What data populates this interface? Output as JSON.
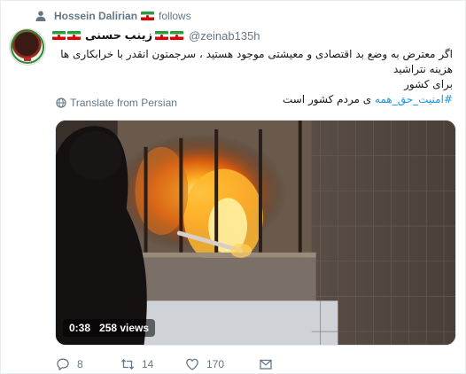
{
  "context": {
    "user_name": "Hossein Dalirian",
    "action": "follows",
    "icon": "person-icon"
  },
  "author": {
    "display_name": "زینب حسنی",
    "handle": "@zeinab135h"
  },
  "tweet": {
    "line1": "اگر معترض به وضع بد اقتصادی و معیشتی موجود هستید ، سرجمتون انقدر با خرابکاری ها هزینه نتراشید",
    "line2": "برای کشور",
    "hashtag": "#امنیت_حق_همه",
    "line3_rest": "ی مردم کشور است"
  },
  "translate": {
    "label": "Translate from Persian",
    "icon": "globe-icon"
  },
  "media": {
    "time": "0:38",
    "views": "258 views"
  },
  "actions": {
    "reply_count": "8",
    "retweet_count": "14",
    "like_count": "170",
    "icons": [
      "reply-icon",
      "retweet-icon",
      "like-icon",
      "message-icon"
    ]
  },
  "colors": {
    "link": "#1b95e0",
    "secondary_text": "#657786",
    "primary_text": "#14171a"
  }
}
